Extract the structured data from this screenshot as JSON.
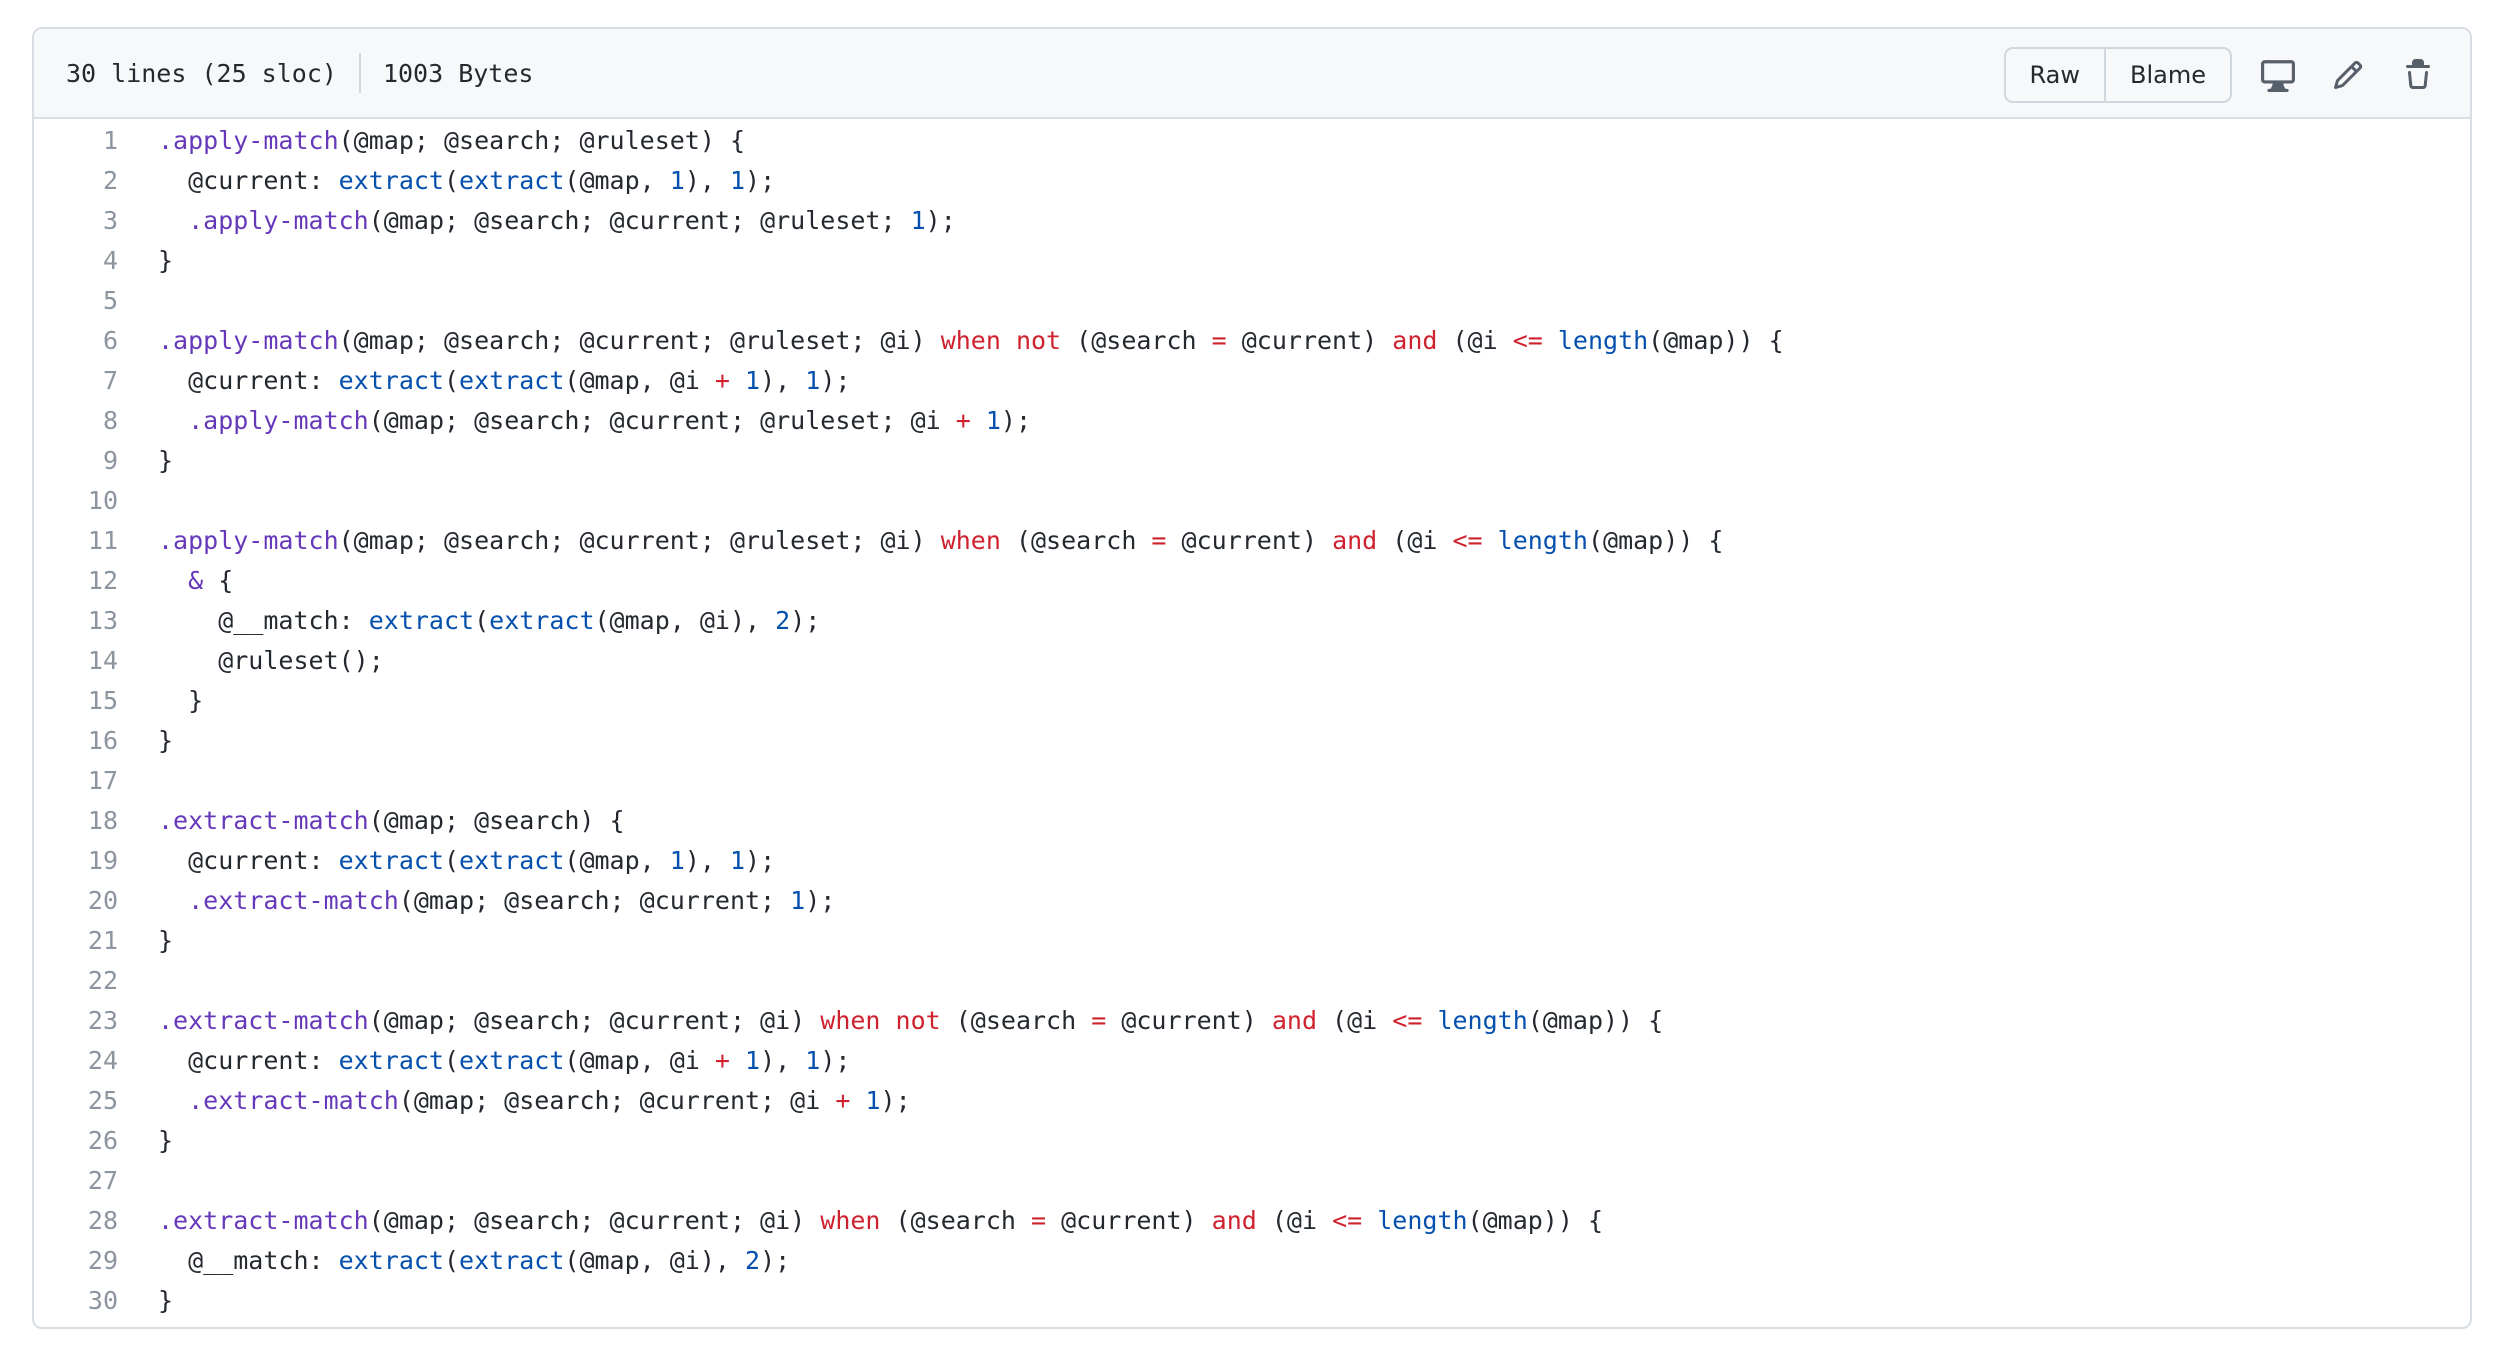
{
  "file_header": {
    "lines_info": "30 lines (25 sloc)",
    "size": "1003 Bytes",
    "raw_label": "Raw",
    "blame_label": "Blame"
  },
  "icons": {
    "display": "desktop-icon",
    "edit": "pencil-icon",
    "delete": "trash-icon"
  },
  "colors": {
    "function": "#6639ba",
    "builtin": "#0550ae",
    "keyword": "#cf222e",
    "number": "#0550ae",
    "text": "#24292f"
  },
  "code_lines": [
    [
      [
        "fn",
        ".apply-match"
      ],
      [
        "tx",
        "(@map; @search; @ruleset) {"
      ]
    ],
    [
      [
        "tx",
        "  @current: "
      ],
      [
        "bi",
        "extract"
      ],
      [
        "tx",
        "("
      ],
      [
        "bi",
        "extract"
      ],
      [
        "tx",
        "(@map, "
      ],
      [
        "nb",
        "1"
      ],
      [
        "tx",
        "), "
      ],
      [
        "nb",
        "1"
      ],
      [
        "tx",
        ");"
      ]
    ],
    [
      [
        "tx",
        "  "
      ],
      [
        "fn",
        ".apply-match"
      ],
      [
        "tx",
        "(@map; @search; @current; @ruleset; "
      ],
      [
        "nb",
        "1"
      ],
      [
        "tx",
        ");"
      ]
    ],
    [
      [
        "tx",
        "}"
      ]
    ],
    [],
    [
      [
        "fn",
        ".apply-match"
      ],
      [
        "tx",
        "(@map; @search; @current; @ruleset; @i) "
      ],
      [
        "kw",
        "when not"
      ],
      [
        "tx",
        " (@search "
      ],
      [
        "op",
        "="
      ],
      [
        "tx",
        " @current) "
      ],
      [
        "kw",
        "and"
      ],
      [
        "tx",
        " (@i "
      ],
      [
        "op",
        "<="
      ],
      [
        "tx",
        " "
      ],
      [
        "bi",
        "length"
      ],
      [
        "tx",
        "(@map)) {"
      ]
    ],
    [
      [
        "tx",
        "  @current: "
      ],
      [
        "bi",
        "extract"
      ],
      [
        "tx",
        "("
      ],
      [
        "bi",
        "extract"
      ],
      [
        "tx",
        "(@map, @i "
      ],
      [
        "op",
        "+"
      ],
      [
        "tx",
        " "
      ],
      [
        "nb",
        "1"
      ],
      [
        "tx",
        "), "
      ],
      [
        "nb",
        "1"
      ],
      [
        "tx",
        ");"
      ]
    ],
    [
      [
        "tx",
        "  "
      ],
      [
        "fn",
        ".apply-match"
      ],
      [
        "tx",
        "(@map; @search; @current; @ruleset; @i "
      ],
      [
        "op",
        "+"
      ],
      [
        "tx",
        " "
      ],
      [
        "nb",
        "1"
      ],
      [
        "tx",
        ");"
      ]
    ],
    [
      [
        "tx",
        "}"
      ]
    ],
    [],
    [
      [
        "fn",
        ".apply-match"
      ],
      [
        "tx",
        "(@map; @search; @current; @ruleset; @i) "
      ],
      [
        "kw",
        "when"
      ],
      [
        "tx",
        " (@search "
      ],
      [
        "op",
        "="
      ],
      [
        "tx",
        " @current) "
      ],
      [
        "kw",
        "and"
      ],
      [
        "tx",
        " (@i "
      ],
      [
        "op",
        "<="
      ],
      [
        "tx",
        " "
      ],
      [
        "bi",
        "length"
      ],
      [
        "tx",
        "(@map)) {"
      ]
    ],
    [
      [
        "tx",
        "  "
      ],
      [
        "am",
        "&"
      ],
      [
        "tx",
        " {"
      ]
    ],
    [
      [
        "tx",
        "    @__match: "
      ],
      [
        "bi",
        "extract"
      ],
      [
        "tx",
        "("
      ],
      [
        "bi",
        "extract"
      ],
      [
        "tx",
        "(@map, @i), "
      ],
      [
        "nb",
        "2"
      ],
      [
        "tx",
        ");"
      ]
    ],
    [
      [
        "tx",
        "    @ruleset();"
      ]
    ],
    [
      [
        "tx",
        "  }"
      ]
    ],
    [
      [
        "tx",
        "}"
      ]
    ],
    [],
    [
      [
        "fn",
        ".extract-match"
      ],
      [
        "tx",
        "(@map; @search) {"
      ]
    ],
    [
      [
        "tx",
        "  @current: "
      ],
      [
        "bi",
        "extract"
      ],
      [
        "tx",
        "("
      ],
      [
        "bi",
        "extract"
      ],
      [
        "tx",
        "(@map, "
      ],
      [
        "nb",
        "1"
      ],
      [
        "tx",
        "), "
      ],
      [
        "nb",
        "1"
      ],
      [
        "tx",
        ");"
      ]
    ],
    [
      [
        "tx",
        "  "
      ],
      [
        "fn",
        ".extract-match"
      ],
      [
        "tx",
        "(@map; @search; @current; "
      ],
      [
        "nb",
        "1"
      ],
      [
        "tx",
        ");"
      ]
    ],
    [
      [
        "tx",
        "}"
      ]
    ],
    [],
    [
      [
        "fn",
        ".extract-match"
      ],
      [
        "tx",
        "(@map; @search; @current; @i) "
      ],
      [
        "kw",
        "when not"
      ],
      [
        "tx",
        " (@search "
      ],
      [
        "op",
        "="
      ],
      [
        "tx",
        " @current) "
      ],
      [
        "kw",
        "and"
      ],
      [
        "tx",
        " (@i "
      ],
      [
        "op",
        "<="
      ],
      [
        "tx",
        " "
      ],
      [
        "bi",
        "length"
      ],
      [
        "tx",
        "(@map)) {"
      ]
    ],
    [
      [
        "tx",
        "  @current: "
      ],
      [
        "bi",
        "extract"
      ],
      [
        "tx",
        "("
      ],
      [
        "bi",
        "extract"
      ],
      [
        "tx",
        "(@map, @i "
      ],
      [
        "op",
        "+"
      ],
      [
        "tx",
        " "
      ],
      [
        "nb",
        "1"
      ],
      [
        "tx",
        "), "
      ],
      [
        "nb",
        "1"
      ],
      [
        "tx",
        ");"
      ]
    ],
    [
      [
        "tx",
        "  "
      ],
      [
        "fn",
        ".extract-match"
      ],
      [
        "tx",
        "(@map; @search; @current; @i "
      ],
      [
        "op",
        "+"
      ],
      [
        "tx",
        " "
      ],
      [
        "nb",
        "1"
      ],
      [
        "tx",
        ");"
      ]
    ],
    [
      [
        "tx",
        "}"
      ]
    ],
    [],
    [
      [
        "fn",
        ".extract-match"
      ],
      [
        "tx",
        "(@map; @search; @current; @i) "
      ],
      [
        "kw",
        "when"
      ],
      [
        "tx",
        " (@search "
      ],
      [
        "op",
        "="
      ],
      [
        "tx",
        " @current) "
      ],
      [
        "kw",
        "and"
      ],
      [
        "tx",
        " (@i "
      ],
      [
        "op",
        "<="
      ],
      [
        "tx",
        " "
      ],
      [
        "bi",
        "length"
      ],
      [
        "tx",
        "(@map)) {"
      ]
    ],
    [
      [
        "tx",
        "  @__match: "
      ],
      [
        "bi",
        "extract"
      ],
      [
        "tx",
        "("
      ],
      [
        "bi",
        "extract"
      ],
      [
        "tx",
        "(@map, @i), "
      ],
      [
        "nb",
        "2"
      ],
      [
        "tx",
        ");"
      ]
    ],
    [
      [
        "tx",
        "}"
      ]
    ]
  ]
}
